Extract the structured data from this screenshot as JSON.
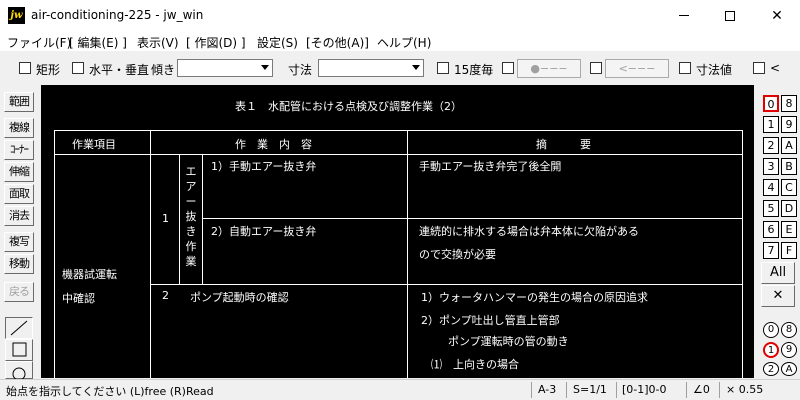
{
  "window": {
    "logo": "jw",
    "title": "air-conditioning-225 - jw_win"
  },
  "menu": [
    "ファイル(F)",
    "[ 編集(E) ]",
    "表示(V)",
    "[ 作図(D) ]",
    "設定(S)",
    "[その他(A)]",
    "ヘルプ(H)"
  ],
  "toolbar": {
    "rect_label": "矩形",
    "hv_label": "水平・垂直",
    "angle_label": "傾き",
    "angle_value": "",
    "dimension_label": "寸法",
    "dimension_value": "",
    "deg15_label": "15度毎",
    "line_btn1": "●−−−",
    "line_btn2": "<−−−",
    "dimval_label": "寸法値",
    "lt_label": "<"
  },
  "left_tools": [
    "範囲",
    "複線",
    "ｺｰﾅｰ",
    "伸縮",
    "面取",
    "消去",
    "複写",
    "移動",
    "戻る"
  ],
  "canvas": {
    "title": "表１　水配管における点検及び調整作業（2）",
    "headers": {
      "item": "作業項目",
      "content": "作　業　内　容",
      "summary": "摘　　　要"
    },
    "item_line1": "機器試運転",
    "item_line2": "中確認",
    "row1_no": "1",
    "row1_group": [
      "エ",
      "ア",
      "ー",
      "抜",
      "き",
      "作",
      "業"
    ],
    "row1a_content": "1）手動エアー抜き弁",
    "row1a_summary": "手動エアー抜き弁完了後全開",
    "row1b_content": "2）自動エアー抜き弁",
    "row1b_summary_1": "連続的に排水する場合は弁本体に欠陥がある",
    "row1b_summary_2": "ので交換が必要",
    "row2_no": "2",
    "row2_content": "ポンプ起動時の確認",
    "row2_summary_1": "1）ウォータハンマーの発生の場合の原因追求",
    "row2_summary_2": "2）ポンプ吐出し管直上管部",
    "row2_summary_3": "ポンプ運転時の管の動き",
    "row2_summary_4": "⑴　上向きの場合"
  },
  "right_palette": {
    "layers_left": [
      "0",
      "1",
      "2",
      "3",
      "4",
      "5",
      "6",
      "7"
    ],
    "layers_right": [
      "8",
      "9",
      "A",
      "B",
      "C",
      "D",
      "E",
      "F"
    ],
    "all_label": "All",
    "x_label": "✕",
    "groups_left": [
      "0",
      "1",
      "2"
    ],
    "groups_right": [
      "8",
      "9",
      "A"
    ]
  },
  "status": {
    "message": "始点を指示してください (L)free (R)Read",
    "paper": "A-3",
    "scale": "S=1/1",
    "layer": "[0-1]0-0",
    "angle": "∠0",
    "factor": "× 0.55"
  },
  "colors": {
    "canvas_bg": "#000000",
    "canvas_line": "#ffffff",
    "selected_layer": "#e00000"
  }
}
